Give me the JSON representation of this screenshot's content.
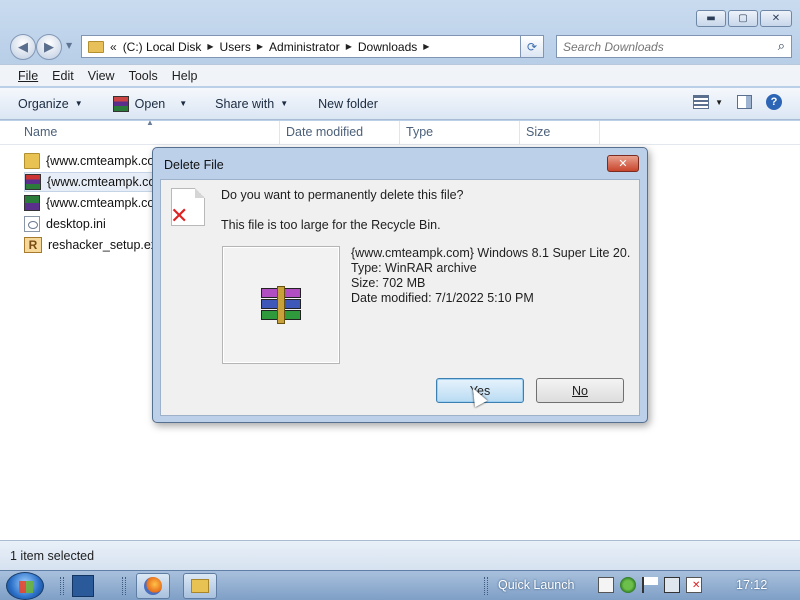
{
  "window": {
    "caption_buttons": {
      "minimize": "▬",
      "maximize": "▢",
      "close": "✕"
    }
  },
  "address_bar": {
    "crumbs": [
      "(C:) Local Disk",
      "Users",
      "Administrator",
      "Downloads"
    ],
    "overflow": "«"
  },
  "search": {
    "placeholder": "Search Downloads"
  },
  "menu": {
    "file": "File",
    "edit": "Edit",
    "view": "View",
    "tools": "Tools",
    "help": "Help"
  },
  "commandbar": {
    "organize": "Organize",
    "open": "Open",
    "share_with": "Share with",
    "new_folder": "New folder"
  },
  "columns": {
    "name": "Name",
    "date_modified": "Date modified",
    "type": "Type",
    "size": "Size"
  },
  "files": [
    {
      "name": "{www.cmteampk.co",
      "icon": "folder-icon"
    },
    {
      "name": "{www.cmteampk.co",
      "icon": "winrar-icon",
      "selected": true
    },
    {
      "name": "{www.cmteampk.co",
      "icon": "iso-icon"
    },
    {
      "name": "desktop.ini",
      "icon": "ini-icon"
    },
    {
      "name": "reshacker_setup.exe",
      "icon": "reshacker-icon"
    }
  ],
  "status": {
    "text": "1 item selected"
  },
  "dialog": {
    "title": "Delete File",
    "close_glyph": "✕",
    "question": "Do you want to permanently delete this file?",
    "note": "This file is too large for the Recycle Bin.",
    "file_name": "{www.cmteampk.com} Windows 8.1 Super Lite 20...",
    "file_type": "Type: WinRAR archive",
    "file_size": "Size: 702 MB",
    "file_date": "Date modified: 7/1/2022 5:10 PM",
    "yes": "Yes",
    "no": "No"
  },
  "taskbar": {
    "quick_launch": "Quick Launch",
    "clock": "17:12"
  }
}
